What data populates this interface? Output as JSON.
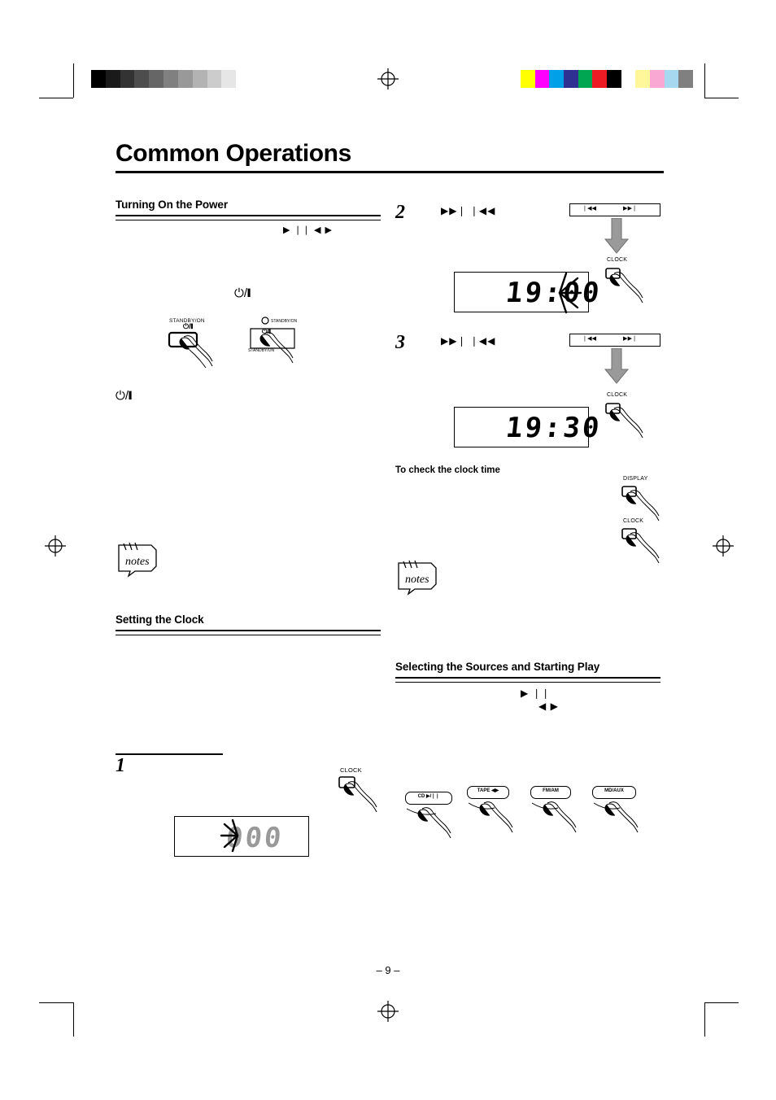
{
  "document": {
    "title": "Common Operations",
    "page_number": "– 9 –"
  },
  "sections": {
    "turning_on_power": {
      "heading": "Turning On the Power",
      "glyphs_row": "▶ ❘❘          ◀ ▶",
      "power_symbol_top": "⏻/❙",
      "power_symbol_left": "⏻/❙",
      "unit_button_label": "STANDBY/ON",
      "unit_button_symbol": "⏻/❙",
      "remote_indicator_label": "STANDBY/ON",
      "remote_button_symbol": "⏻/❙",
      "remote_button_label": "STANDBY/ON"
    },
    "setting_the_clock": {
      "heading": "Setting the Clock",
      "steps": [
        {
          "number": "1",
          "display_value": "000",
          "clock_button_label": "CLOCK"
        },
        {
          "number": "2",
          "glyphs": "▶▶❘      ❘◀◀",
          "strip_left_label": "❘◀◀",
          "strip_right_label": "▶▶❘",
          "clock_button_label": "CLOCK",
          "display_value": "19:00"
        },
        {
          "number": "3",
          "glyphs": "▶▶❘      ❘◀◀",
          "strip_left_label": "❘◀◀",
          "strip_right_label": "▶▶❘",
          "clock_button_label": "CLOCK",
          "display_value": "19:30"
        }
      ],
      "check_clock": {
        "subheading": "To check the clock time",
        "display_button_label": "DISPLAY",
        "clock_button_label": "CLOCK"
      }
    },
    "selecting_sources": {
      "heading": "Selecting the Sources and Starting Play",
      "glyph_play": "▶ ❘❘",
      "glyph_skip": "◀ ▶",
      "clock_button_label": "CLOCK",
      "source_buttons": [
        {
          "label": "CD ▶/❘❘"
        },
        {
          "label": "TAPE ◀▶"
        },
        {
          "label": "FM/AM"
        },
        {
          "label": "MD/AUX"
        }
      ]
    }
  },
  "notes_icon_label": "notes",
  "colors": {
    "gray_steps": [
      "#000000",
      "#1a1a1a",
      "#333333",
      "#4d4d4d",
      "#666666",
      "#808080",
      "#999999",
      "#b3b3b3",
      "#cccccc",
      "#e6e6e6",
      "#ffffff"
    ],
    "color_bar": [
      "#ffff00",
      "#ff00ff",
      "#00a0e9",
      "#2e3192",
      "#00a651",
      "#ed1c24",
      "#000000",
      "#ffffff",
      "#fff799",
      "#f9a8d4",
      "#a6d8f0",
      "#808080"
    ]
  }
}
